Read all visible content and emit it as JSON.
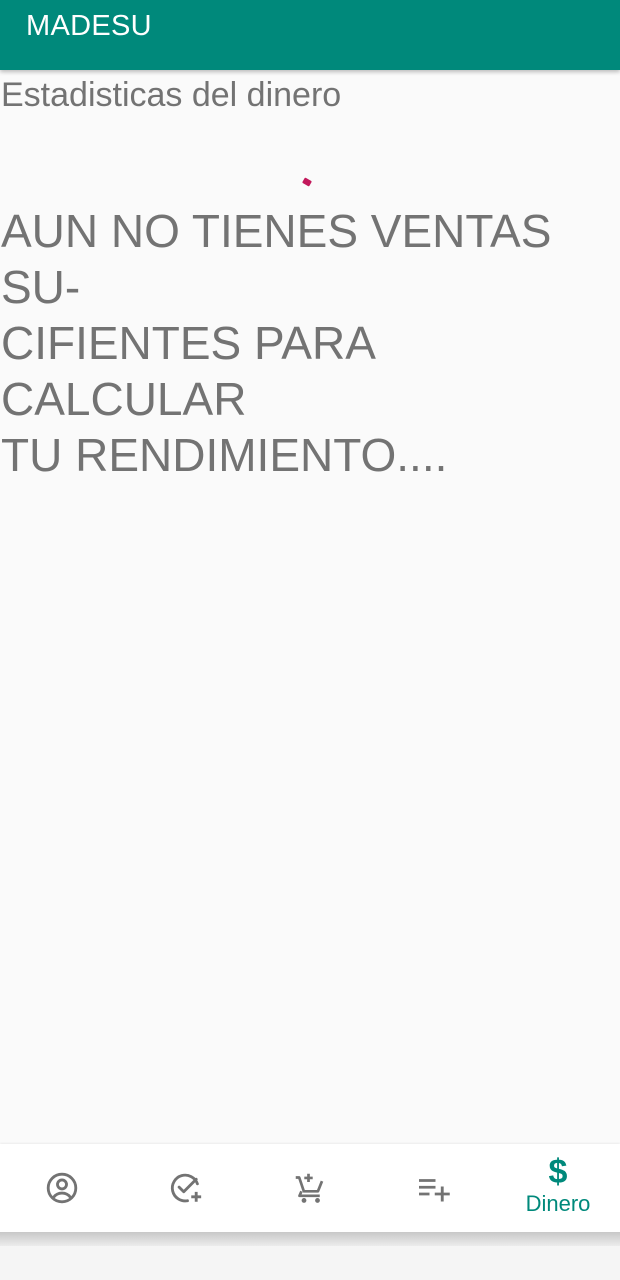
{
  "app": {
    "title": "MADESU"
  },
  "content": {
    "section_title": "Estadisticas del dinero",
    "message": "AUN NO TIENES VENTAS SU-\nCIFIENTES PARA CALCULAR\nTU RENDIMIENTO...."
  },
  "bottom_nav": {
    "items": [
      {
        "icon": "account-circle-icon",
        "label": ""
      },
      {
        "icon": "check-circle-add-icon",
        "label": ""
      },
      {
        "icon": "cart-add-icon",
        "label": ""
      },
      {
        "icon": "playlist-add-icon",
        "label": ""
      },
      {
        "icon": "dollar-icon",
        "label": "Dinero",
        "glyph": "$"
      }
    ],
    "active_index": 4
  },
  "colors": {
    "primary": "#00897b",
    "accent": "#c2185b",
    "text_secondary": "#737373",
    "background": "#fafafa"
  }
}
